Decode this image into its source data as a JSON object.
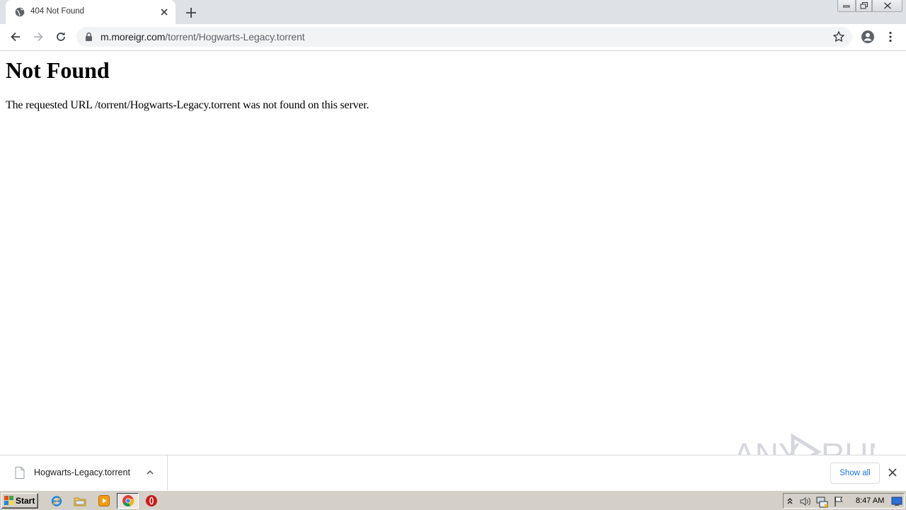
{
  "browser": {
    "tab": {
      "title": "404 Not Found"
    },
    "omnibox": {
      "host": "m.moreigr.com",
      "path": "/torrent/Hogwarts-Legacy.torrent"
    }
  },
  "page": {
    "heading": "Not Found",
    "message": "The requested URL /torrent/Hogwarts-Legacy.torrent was not found on this server."
  },
  "download_bar": {
    "file_name": "Hogwarts-Legacy.torrent",
    "show_all_label": "Show all"
  },
  "taskbar": {
    "start_label": "Start",
    "clock": "8:47 AM"
  },
  "watermark": {
    "text": "ANY RUN"
  },
  "colors": {
    "tabstrip": "#dee1e6",
    "omnibox": "#f1f3f4",
    "link_blue": "#1a73e8",
    "taskbar": "#d4d0c8"
  }
}
